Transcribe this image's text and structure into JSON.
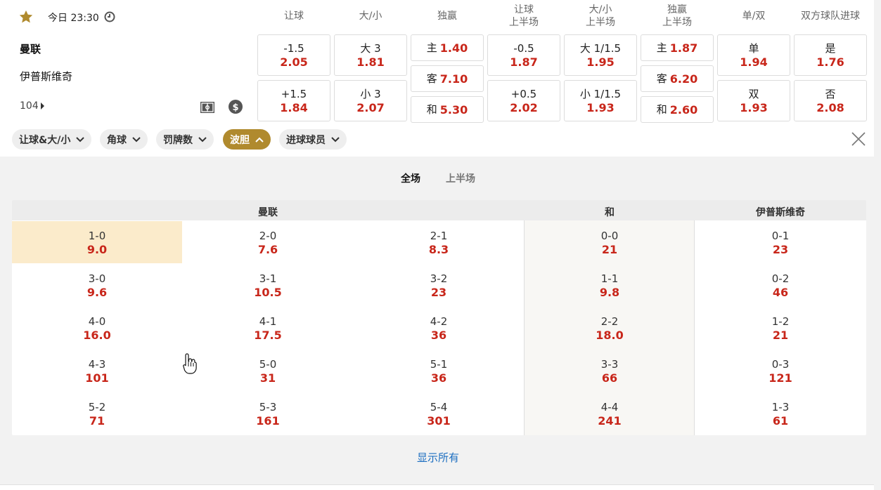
{
  "match": {
    "time": "今日 23:30",
    "home": "曼联",
    "away": "伊普斯维奇",
    "more_count": "104"
  },
  "markets": [
    {
      "title": [
        "让球"
      ],
      "cells": [
        {
          "label": "-1.5",
          "odds": "2.05"
        },
        {
          "label": "+1.5",
          "odds": "1.84"
        }
      ]
    },
    {
      "title": [
        "大/小"
      ],
      "cells": [
        {
          "label": "大 3",
          "odds": "1.81"
        },
        {
          "label": "小 3",
          "odds": "2.07"
        }
      ]
    },
    {
      "title": [
        "独赢"
      ],
      "cells": [
        {
          "label": "主",
          "odds": "1.40"
        },
        {
          "label": "客",
          "odds": "7.10"
        },
        {
          "label": "和",
          "odds": "5.30"
        }
      ]
    },
    {
      "title": [
        "让球",
        "上半场"
      ],
      "cells": [
        {
          "label": "-0.5",
          "odds": "1.87"
        },
        {
          "label": "+0.5",
          "odds": "2.02"
        }
      ]
    },
    {
      "title": [
        "大/小",
        "上半场"
      ],
      "cells": [
        {
          "label": "大 1/1.5",
          "odds": "1.95"
        },
        {
          "label": "小 1/1.5",
          "odds": "1.93"
        }
      ]
    },
    {
      "title": [
        "独赢",
        "上半场"
      ],
      "cells": [
        {
          "label": "主",
          "odds": "1.87"
        },
        {
          "label": "客",
          "odds": "6.20"
        },
        {
          "label": "和",
          "odds": "2.60"
        }
      ]
    },
    {
      "title": [
        "单/双"
      ],
      "cells": [
        {
          "label": "单",
          "odds": "1.94"
        },
        {
          "label": "双",
          "odds": "1.93"
        }
      ]
    },
    {
      "title": [
        "双方球队进球"
      ],
      "cells": [
        {
          "label": "是",
          "odds": "1.76"
        },
        {
          "label": "否",
          "odds": "2.08"
        }
      ]
    }
  ],
  "filters": [
    {
      "label": "让球&大/小",
      "active": false
    },
    {
      "label": "角球",
      "active": false
    },
    {
      "label": "罚牌数",
      "active": false
    },
    {
      "label": "波胆",
      "active": true
    },
    {
      "label": "进球球员",
      "active": false
    }
  ],
  "period_tabs": {
    "full": "全场",
    "half": "上半场"
  },
  "correct_score": {
    "headers": {
      "home": "曼联",
      "draw": "和",
      "away": "伊普斯维奇"
    },
    "columns": [
      [
        {
          "s": "1-0",
          "o": "9.0"
        },
        {
          "s": "3-0",
          "o": "9.6"
        },
        {
          "s": "4-0",
          "o": "16.0"
        },
        {
          "s": "4-3",
          "o": "101"
        },
        {
          "s": "5-2",
          "o": "71"
        }
      ],
      [
        {
          "s": "2-0",
          "o": "7.6"
        },
        {
          "s": "3-1",
          "o": "10.5"
        },
        {
          "s": "4-1",
          "o": "17.5"
        },
        {
          "s": "5-0",
          "o": "31"
        },
        {
          "s": "5-3",
          "o": "161"
        }
      ],
      [
        {
          "s": "2-1",
          "o": "8.3"
        },
        {
          "s": "3-2",
          "o": "23"
        },
        {
          "s": "4-2",
          "o": "36"
        },
        {
          "s": "5-1",
          "o": "36"
        },
        {
          "s": "5-4",
          "o": "301"
        }
      ],
      [
        {
          "s": "0-0",
          "o": "21"
        },
        {
          "s": "1-1",
          "o": "9.8"
        },
        {
          "s": "2-2",
          "o": "18.0"
        },
        {
          "s": "3-3",
          "o": "66"
        },
        {
          "s": "4-4",
          "o": "241"
        }
      ],
      [
        {
          "s": "0-1",
          "o": "23"
        },
        {
          "s": "0-2",
          "o": "46"
        },
        {
          "s": "1-2",
          "o": "21"
        },
        {
          "s": "0-3",
          "o": "121"
        },
        {
          "s": "1-3",
          "o": "61"
        }
      ]
    ]
  },
  "show_all": "显示所有",
  "colors": {
    "accent": "#b08a2e",
    "odds": "#c8261a",
    "link": "#1c6ec0",
    "highlight": "#fbebcb"
  }
}
